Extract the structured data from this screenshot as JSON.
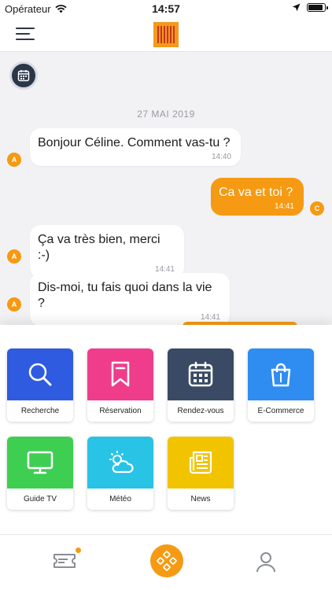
{
  "status_bar": {
    "carrier": "Opérateur",
    "time": "14:57",
    "battery_level": 0.9
  },
  "header": {
    "logo_icon": "yellow-logo",
    "menu_icon": "hamburger-menu-icon"
  },
  "chat": {
    "date": "27 MAI 2019",
    "messages": [
      {
        "from": "in",
        "avatar": "A",
        "text": "Bonjour Céline. Comment vas-tu ?",
        "time": "14:40"
      },
      {
        "from": "out",
        "avatar": "C",
        "text": "Ca va et toi ?",
        "time": "14:41"
      },
      {
        "from": "in",
        "avatar": "A",
        "text": "Ça va très bien, merci :-)",
        "time": "14:41"
      },
      {
        "from": "in",
        "avatar": "A",
        "text": "Dis-moi, tu fais quoi dans la vie ?",
        "time": "14:41"
      }
    ]
  },
  "menu": {
    "tiles": [
      {
        "label": "Recherche",
        "icon": "search-icon",
        "color": "#2f5be0"
      },
      {
        "label": "Réservation",
        "icon": "bookmark-icon",
        "color": "#ef3d8c"
      },
      {
        "label": "Rendez-vous",
        "icon": "calendar-icon",
        "color": "#3a4a64"
      },
      {
        "label": "E-Commerce",
        "icon": "shopping-bag-icon",
        "color": "#2f8cf0"
      },
      {
        "label": "Guide TV",
        "icon": "tv-icon",
        "color": "#3ecf52"
      },
      {
        "label": "Météo",
        "icon": "weather-icon",
        "color": "#29c3e6"
      },
      {
        "label": "News",
        "icon": "newspaper-icon",
        "color": "#f2c400"
      }
    ]
  },
  "tabbar": {
    "items": [
      {
        "icon": "ticket-icon",
        "has_badge": true
      },
      {
        "icon": "apps-icon",
        "active": true
      },
      {
        "icon": "profile-icon"
      }
    ]
  },
  "colors": {
    "accent": "#f59a12",
    "dark": "#2b3648"
  }
}
